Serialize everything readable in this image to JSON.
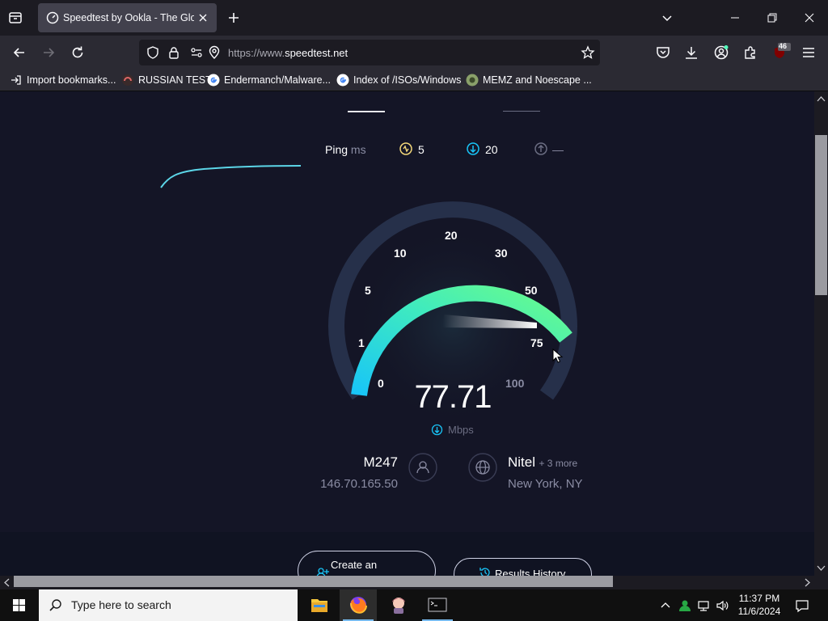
{
  "browser": {
    "tab_title": "Speedtest by Ookla - The Global Broadband Speed Test",
    "url_scheme": "https://www.",
    "url_host": "speedtest.net",
    "extension_badge": "46"
  },
  "bookmarks": [
    {
      "label": "Import bookmarks...",
      "icon": "import-icon"
    },
    {
      "label": "RUSSIAN TEST",
      "icon": "site-icon"
    },
    {
      "label": "Endermanch/Malware...",
      "icon": "google-icon"
    },
    {
      "label": "Index of /ISOs/Windows",
      "icon": "google-icon"
    },
    {
      "label": "MEMZ and Noescape ...",
      "icon": "site-icon"
    }
  ],
  "speedtest": {
    "ping_label": "Ping",
    "ping_unit": "ms",
    "jitter_value": "5",
    "download_ping": "20",
    "upload_ping": "—",
    "gauge_labels": [
      "0",
      "1",
      "5",
      "10",
      "20",
      "30",
      "50",
      "75",
      "100"
    ],
    "current_speed": "77.71",
    "speed_unit": "Mbps",
    "current_speed_value": 77.71,
    "isp_name": "M247",
    "isp_ip": "146.70.165.50",
    "server_name": "Nitel",
    "server_more": "+ 3 more",
    "server_location": "New York, NY",
    "create_account_label": "Create an",
    "results_history_label": "Results History"
  },
  "colors": {
    "accent_cyan": "#18c5f8",
    "accent_green": "#6afc8a",
    "page_bg": "#141526"
  },
  "taskbar": {
    "search_placeholder": "Type here to search",
    "time": "11:37 PM",
    "date": "11/6/2024"
  }
}
